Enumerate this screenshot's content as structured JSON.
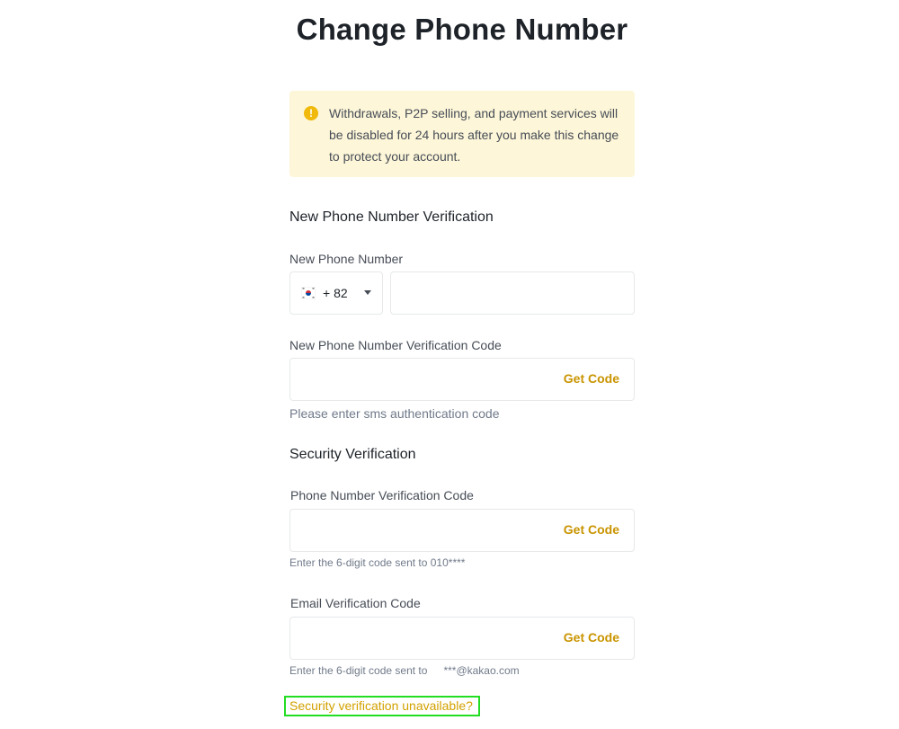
{
  "page": {
    "title": "Change Phone Number"
  },
  "warning": {
    "icon": "exclamation-icon",
    "text": "Withdrawals, P2P selling, and payment services will be disabled for 24 hours after you make this change to protect your account."
  },
  "new_phone_section": {
    "title": "New Phone Number Verification",
    "phone_label": "New Phone Number",
    "country": {
      "flag": "south-korea-flag",
      "dial_code": "+ 82"
    },
    "phone_value": "",
    "code_label": "New Phone Number Verification Code",
    "code_value": "",
    "get_code_label": "Get Code",
    "code_hint": "Please enter sms authentication code"
  },
  "security_section": {
    "title": "Security Verification",
    "phone_code_label": "Phone Number Verification Code",
    "phone_code_value": "",
    "phone_get_code_label": "Get Code",
    "phone_hint": "Enter the 6-digit code sent to 010****",
    "email_code_label": "Email Verification Code",
    "email_code_value": "",
    "email_get_code_label": "Get Code",
    "email_hint_prefix": "Enter the 6-digit code sent to",
    "email_hint_address": "***@kakao.com",
    "unavailable_link": "Security verification unavailable?"
  },
  "colors": {
    "accent": "#c99400",
    "warning_bg": "#fdf6d8",
    "warning_icon": "#f0b90b",
    "highlight_border": "#22dd22"
  }
}
